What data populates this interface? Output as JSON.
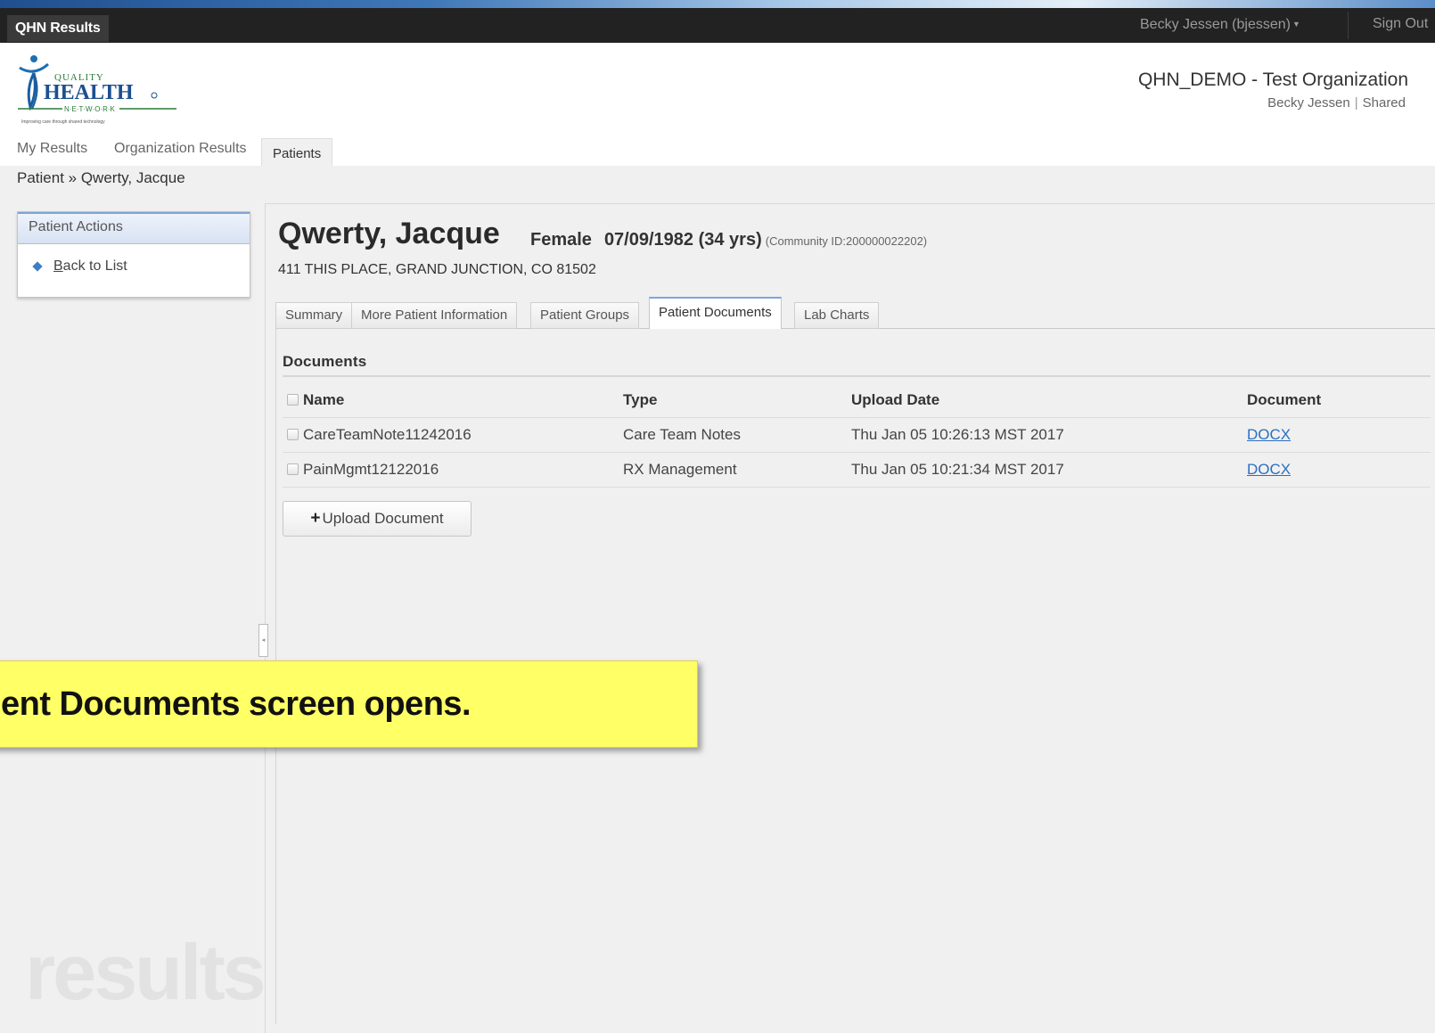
{
  "topbar": {
    "app_title": "QHN Results",
    "user": "Becky Jessen (bjessen)",
    "signout": "Sign Out"
  },
  "logo": {
    "line1": "QUALITY",
    "line2": "HEALTH",
    "line3": "N·E·T·W·O·R·K",
    "tagline": "Improving care through shared technology"
  },
  "org": {
    "name": "QHN_DEMO - Test Organization",
    "user": "Becky Jessen",
    "shared": "Shared"
  },
  "nav": {
    "my_results": "My Results",
    "org_results": "Organization Results",
    "patients": "Patients"
  },
  "breadcrumb": "Patient » Qwerty, Jacque",
  "sidebar": {
    "header": "Patient Actions",
    "back_first": "B",
    "back_rest": "ack to List"
  },
  "patient": {
    "name": "Qwerty, Jacque",
    "gender": "Female",
    "dob": "07/09/1982 (34 yrs)",
    "community_id": "(Community ID:200000022202)",
    "address": "411 THIS PLACE, GRAND JUNCTION, CO 81502"
  },
  "tabs": {
    "summary": "Summary",
    "more_info": "More Patient Information",
    "groups": "Patient Groups",
    "documents": "Patient Documents",
    "lab_charts": "Lab Charts"
  },
  "documents": {
    "title": "Documents",
    "columns": {
      "name": "Name",
      "type": "Type",
      "upload_date": "Upload Date",
      "document": "Document"
    },
    "rows": [
      {
        "name": "CareTeamNote11242016",
        "type": "Care Team Notes",
        "date": "Thu Jan 05 10:26:13 MST 2017",
        "doc": "DOCX"
      },
      {
        "name": "PainMgmt12122016",
        "type": "RX Management",
        "date": "Thu Jan 05 10:21:34 MST 2017",
        "doc": "DOCX"
      }
    ],
    "upload_label": "Upload Document"
  },
  "watermark": "results",
  "callout": "ent Documents screen opens.",
  "colors": {
    "topbar": "#222222",
    "link": "#2a6fc2",
    "callout": "#ffff66",
    "tab_accent": "#7ea4d6"
  }
}
